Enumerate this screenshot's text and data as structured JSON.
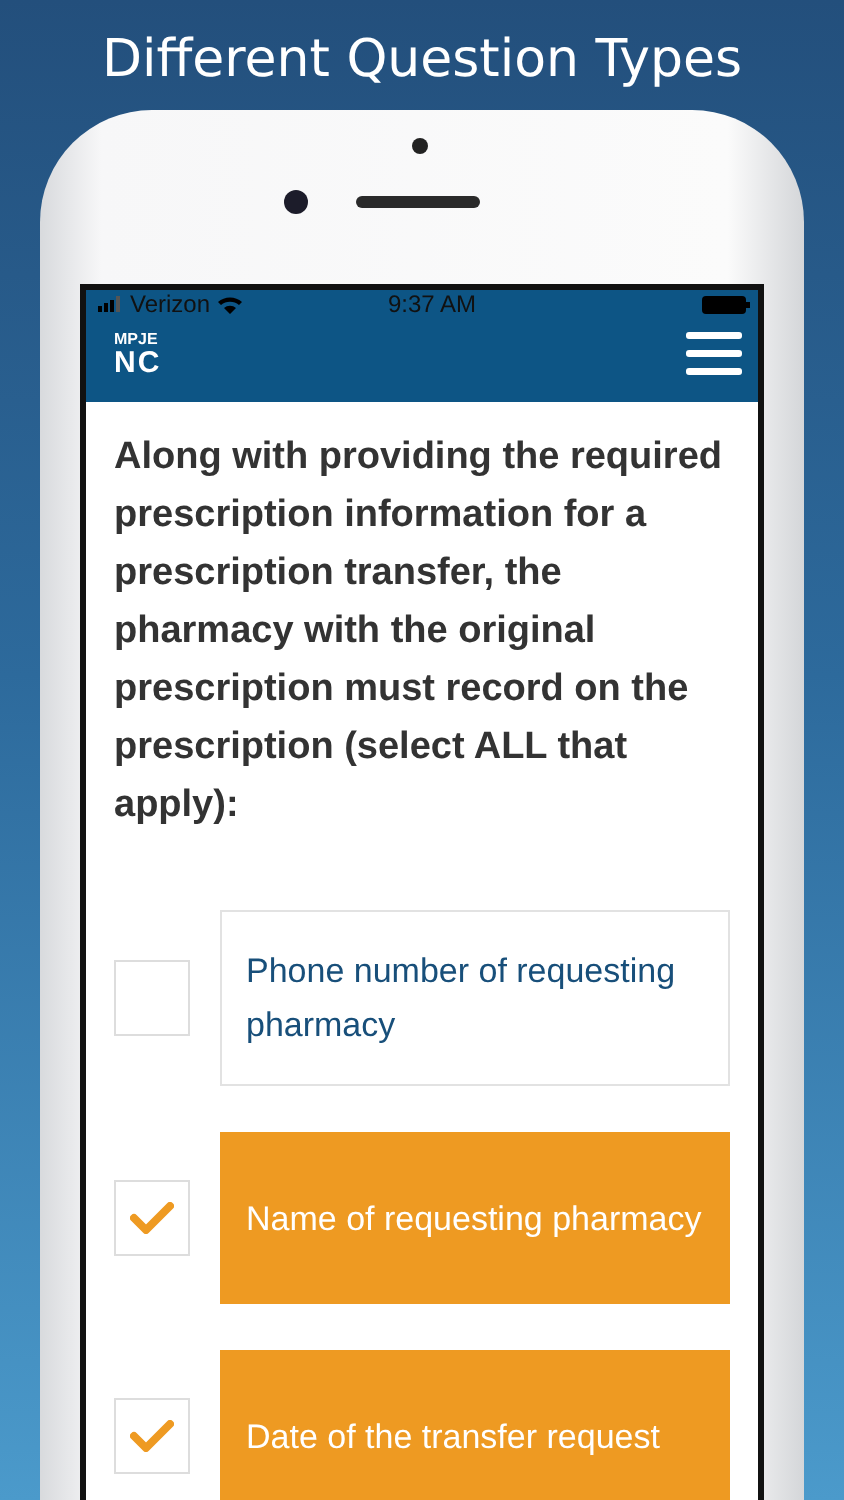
{
  "headline": "Different Question Types",
  "status_bar": {
    "carrier": "Verizon",
    "time": "9:37 AM"
  },
  "header": {
    "logo_top": "MPJE",
    "logo_bottom": "NC"
  },
  "question": "Along with providing the required prescription information for a prescription transfer, the pharmacy with the original prescription must record on the prescription (select ALL that apply):",
  "options": [
    {
      "label": "Phone number of requesting pharmacy",
      "checked": false
    },
    {
      "label": "Name of requesting pharmacy",
      "checked": true
    },
    {
      "label": "Date of the transfer request",
      "checked": true
    }
  ]
}
